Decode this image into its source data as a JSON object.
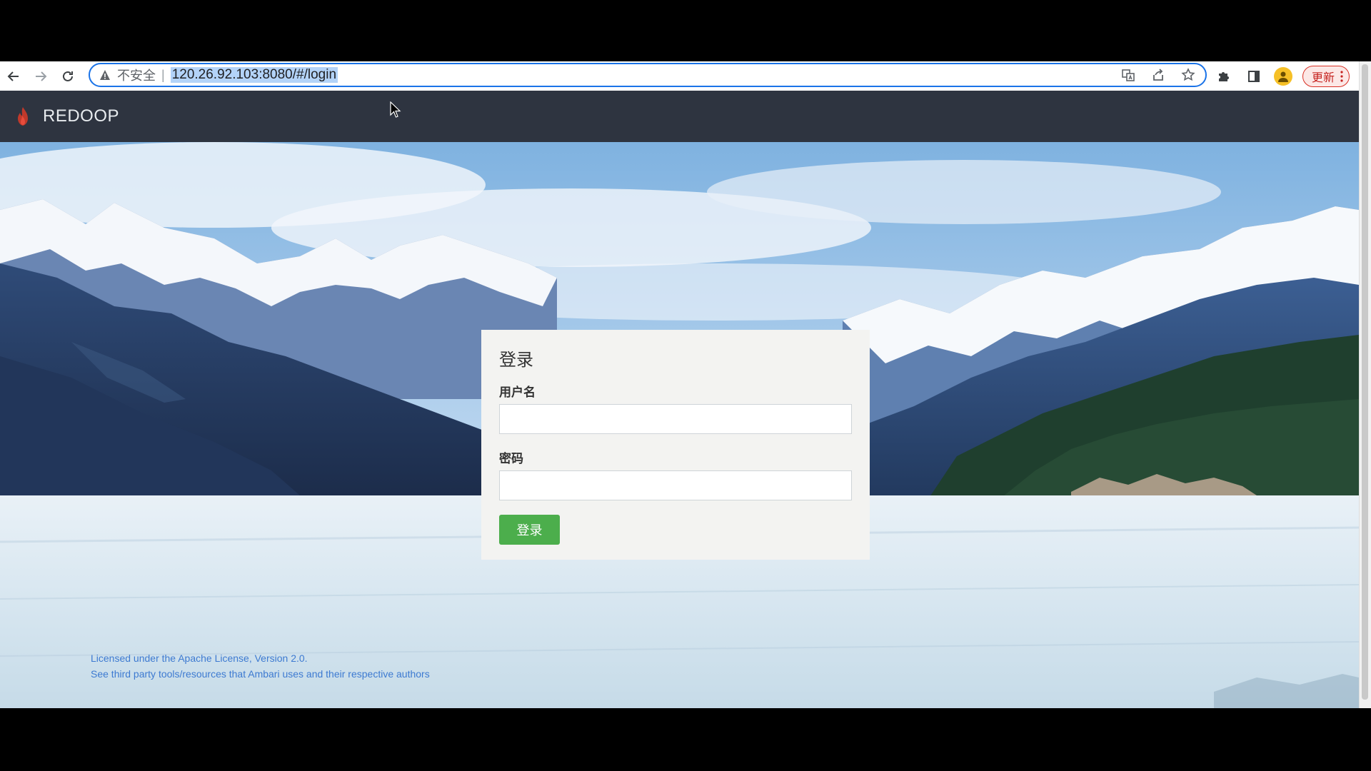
{
  "browser": {
    "insecure_label": "不安全",
    "separator": "|",
    "url": "120.26.92.103:8080/#/login",
    "update_label": "更新"
  },
  "app": {
    "brand": "REDOOP"
  },
  "login": {
    "title": "登录",
    "username_label": "用户名",
    "username_value": "",
    "password_label": "密码",
    "password_value": "",
    "submit_label": "登录"
  },
  "footer": {
    "license": "Licensed under the Apache License, Version 2.0.",
    "third_party": "See third party tools/resources that Ambari uses and their respective authors"
  },
  "colors": {
    "header_bg": "#2e3440",
    "login_button": "#4cae4c",
    "link": "#3d7ad1",
    "omnibox_focus": "#1a73e8"
  }
}
